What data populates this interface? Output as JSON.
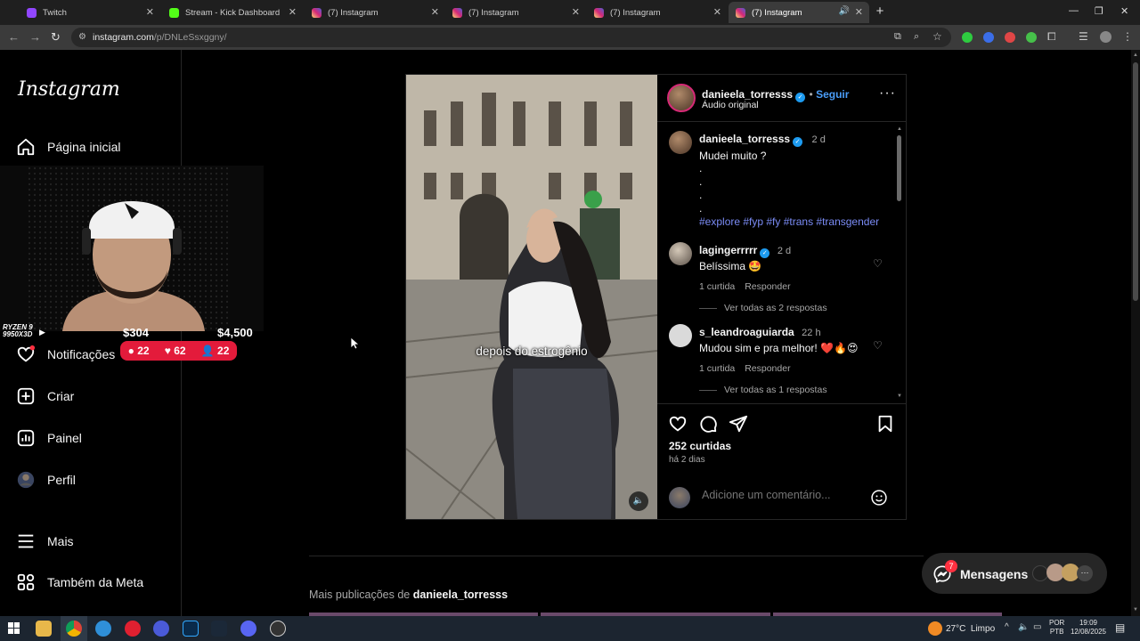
{
  "browser": {
    "tabs": [
      {
        "title": "Twitch",
        "color": "#9146ff"
      },
      {
        "title": "Stream - Kick Dashboard",
        "color": "#53fc18"
      },
      {
        "title": "(7) Instagram",
        "color": "#d62976"
      },
      {
        "title": "(7) Instagram",
        "color": "#d62976"
      },
      {
        "title": "(7) Instagram",
        "color": "#d62976"
      },
      {
        "title": "(7) Instagram",
        "color": "#d62976"
      }
    ],
    "url_host": "instagram.com",
    "url_path": "/p/DNLeSsxggny/"
  },
  "sidebar": {
    "logo": "Instagram",
    "items": [
      {
        "label": "Página inicial",
        "icon": "home-icon"
      },
      {
        "label": "Notificações",
        "icon": "heart-icon"
      },
      {
        "label": "Criar",
        "icon": "plus-square-icon"
      },
      {
        "label": "Painel",
        "icon": "dashboard-icon"
      },
      {
        "label": "Perfil",
        "icon": "avatar"
      },
      {
        "label": "Mais",
        "icon": "menu-icon"
      },
      {
        "label": "Também da Meta",
        "icon": "meta-icon"
      }
    ]
  },
  "stream_overlay": {
    "cpu_label": "RYZEN 9",
    "cpu_model": "9950X3D",
    "amount_left": "$304",
    "amount_right": "$4,500",
    "chat_count": "22",
    "likes_count": "62",
    "viewers_count": "22"
  },
  "post": {
    "username": "danieela_torresss",
    "follow_label": "Seguir",
    "audio": "Áudio original",
    "video_caption": "depois do estrogênio",
    "caption": {
      "username": "danieela_torresss",
      "age": "2 d",
      "text": "Mudei muito ?",
      "dots": [
        ".",
        ".",
        ".",
        "."
      ],
      "tags": "#explore #fyp #fy #trans #transgender"
    },
    "comments": [
      {
        "username": "lagingerrrrr",
        "age": "2 d",
        "text": "Belíssima 🤩",
        "likes": "1 curtida",
        "reply": "Responder",
        "see_replies": "Ver todas as 2 respostas"
      },
      {
        "username": "s_leandroaguiarda",
        "age": "22 h",
        "text": "Mudou sim e pra melhor! ❤️🔥😍",
        "likes": "1 curtida",
        "reply": "Responder",
        "see_replies": "Ver todas as 1 respostas"
      }
    ],
    "like_count": "252 curtidas",
    "posted": "há 2 dias",
    "comment_placeholder": "Adicione um comentário..."
  },
  "more_posts": {
    "prefix": "Mais publicações de",
    "username": "danieela_torresss"
  },
  "messages": {
    "label": "Mensagens",
    "badge": "7"
  },
  "taskbar": {
    "weather": "27°C  Limpo",
    "lang_top": "POR",
    "lang_bottom": "PTB",
    "time": "19:09",
    "date": "12/08/2025"
  }
}
